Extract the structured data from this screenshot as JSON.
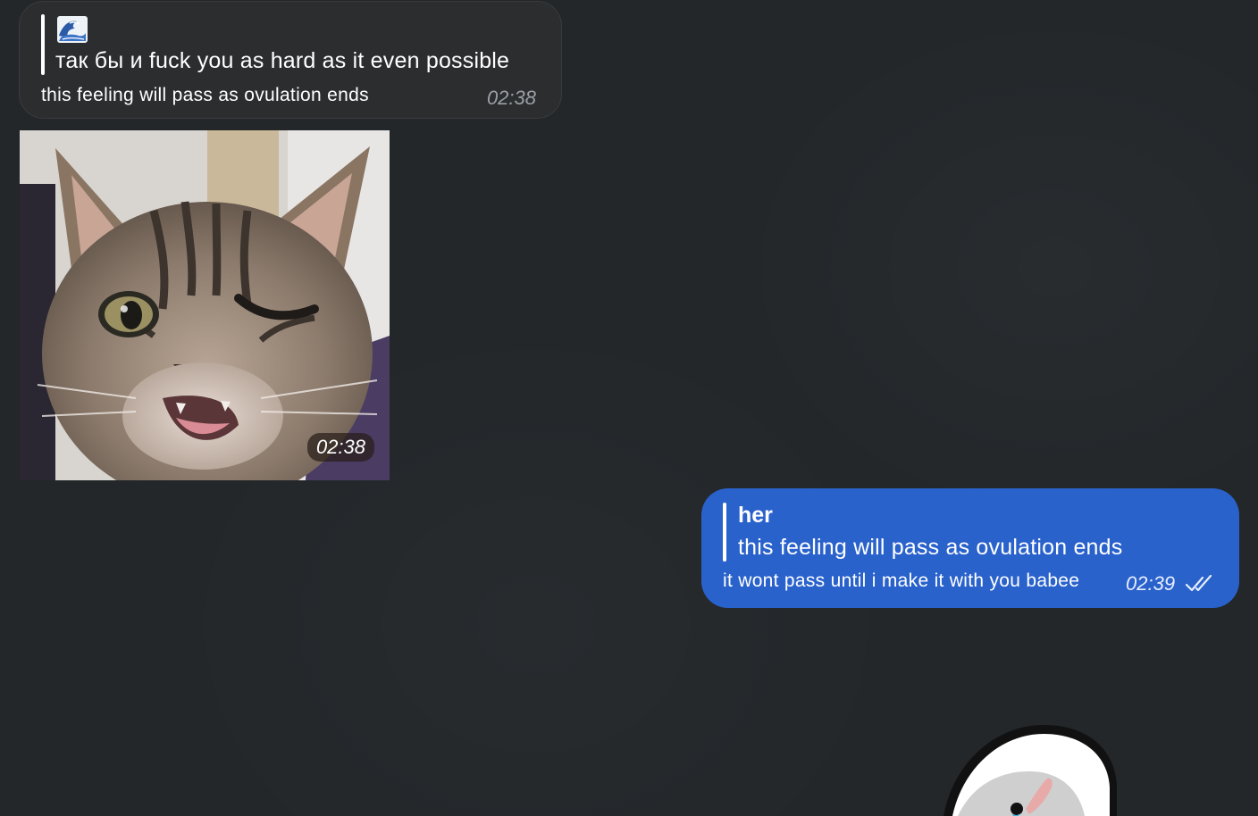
{
  "messages": [
    {
      "type": "text",
      "direction": "incoming",
      "quote": {
        "emoji": "wave-icon",
        "text": "так бы и fuck you as hard as it even possible"
      },
      "text": "this feeling will pass as ovulation ends",
      "time": "02:38"
    },
    {
      "type": "photo",
      "direction": "incoming",
      "subject": "winking-kitten",
      "time": "02:38"
    },
    {
      "type": "text",
      "direction": "outgoing",
      "quote": {
        "author": "her",
        "text": "this feeling will pass as ovulation ends"
      },
      "text": "it wont pass until i make it with you babee",
      "time": "02:39",
      "status_icon": "double-check-icon",
      "status": "read"
    },
    {
      "type": "sticker",
      "direction": "outgoing",
      "subject": "white-blob-sticker"
    }
  ],
  "colors": {
    "background": "#23272a",
    "incoming_bubble": "#2c2d2f",
    "outgoing_bubble": "#2a62cc",
    "quote_bar": "#ffffff",
    "muted_time": "#9aa0a6"
  }
}
